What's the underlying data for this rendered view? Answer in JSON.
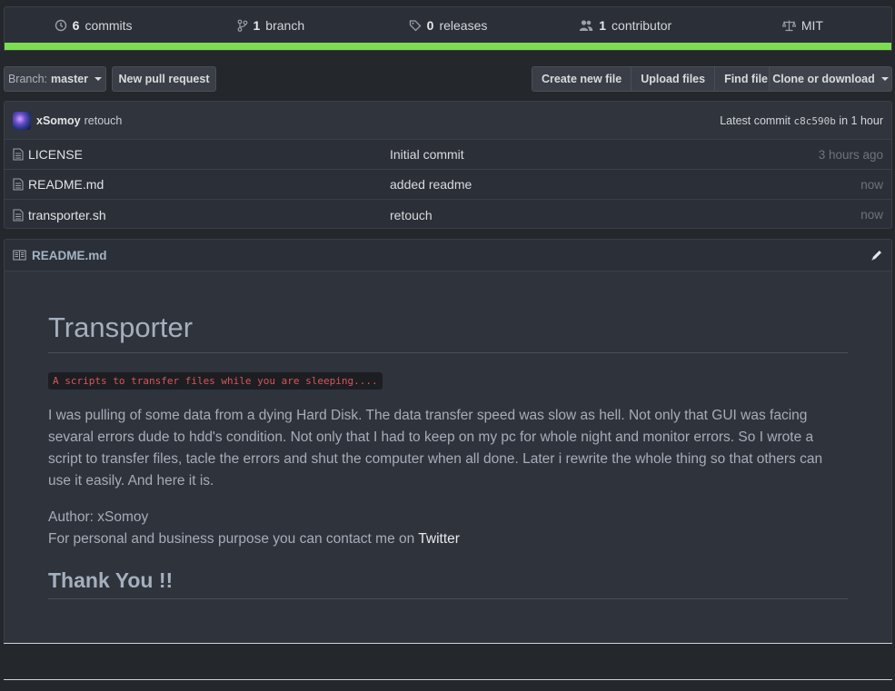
{
  "summary": {
    "commits": {
      "num": "6",
      "label": "commits"
    },
    "branches": {
      "num": "1",
      "label": "branch"
    },
    "releases": {
      "num": "0",
      "label": "releases"
    },
    "contributors": {
      "num": "1",
      "label": "contributor"
    },
    "license": {
      "label": "MIT"
    },
    "language_bar_color": "#7ddc52"
  },
  "toolbar": {
    "branch_prefix": "Branch:",
    "branch_name": "master",
    "new_pull_request": "New pull request",
    "create_new_file": "Create new file",
    "upload_files": "Upload files",
    "find_file": "Find file",
    "clone_or_download": "Clone or download"
  },
  "commit": {
    "author": "xSomoy",
    "message": "retouch",
    "latest_label": "Latest commit",
    "sha": "c8c590b",
    "time": "in 1 hour"
  },
  "files": [
    {
      "name": "LICENSE",
      "message": "Initial commit",
      "age": "3 hours ago"
    },
    {
      "name": "README.md",
      "message": "added readme",
      "age": "now"
    },
    {
      "name": "transporter.sh",
      "message": "retouch",
      "age": "now"
    }
  ],
  "readme": {
    "filename": "README.md",
    "title": "Transporter",
    "code": "A scripts to transfer files while you are sleeping....",
    "paragraph": "I was pulling of some data from a dying Hard Disk. The data transfer speed was slow as hell. Not only that GUI was facing sevaral errors dude to hdd's condition. Not only that I had to keep on my pc for whole night and monitor errors. So I wrote a script to transfer files, tacle the errors and shut the computer when all done. Later i rewrite the whole thing so that others can use it easily. And here it is.",
    "author_line": "Author: xSomoy",
    "contact_text": "For personal and business purpose you can contact me on",
    "contact_link": "Twitter",
    "thanks": "Thank You !!"
  }
}
